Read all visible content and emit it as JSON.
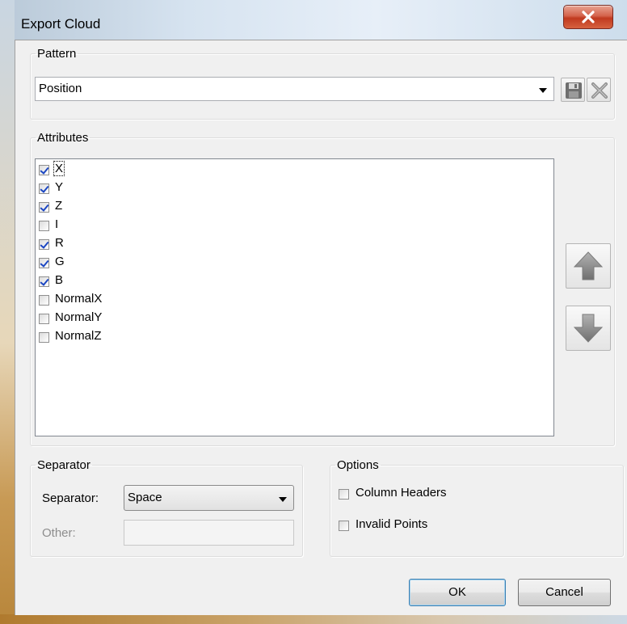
{
  "window": {
    "title": "Export Cloud",
    "close_icon": "close-icon"
  },
  "pattern": {
    "group_label": "Pattern",
    "selected": "Position",
    "save_icon": "save-disk-icon",
    "delete_icon": "delete-x-icon"
  },
  "attributes": {
    "group_label": "Attributes",
    "items": [
      {
        "label": "X",
        "checked": true
      },
      {
        "label": "Y",
        "checked": true
      },
      {
        "label": "Z",
        "checked": true
      },
      {
        "label": "I",
        "checked": false
      },
      {
        "label": "R",
        "checked": true
      },
      {
        "label": "G",
        "checked": true
      },
      {
        "label": "B",
        "checked": true
      },
      {
        "label": "NormalX",
        "checked": false
      },
      {
        "label": "NormalY",
        "checked": false
      },
      {
        "label": "NormalZ",
        "checked": false
      }
    ],
    "move_up_icon": "arrow-up-icon",
    "move_down_icon": "arrow-down-icon"
  },
  "separator": {
    "group_label": "Separator",
    "separator_label": "Separator:",
    "separator_value": "Space",
    "other_label": "Other:",
    "other_value": ""
  },
  "options": {
    "group_label": "Options",
    "column_headers": {
      "label": "Column Headers",
      "checked": false
    },
    "invalid_points": {
      "label": "Invalid Points",
      "checked": false
    }
  },
  "buttons": {
    "ok": "OK",
    "cancel": "Cancel"
  }
}
